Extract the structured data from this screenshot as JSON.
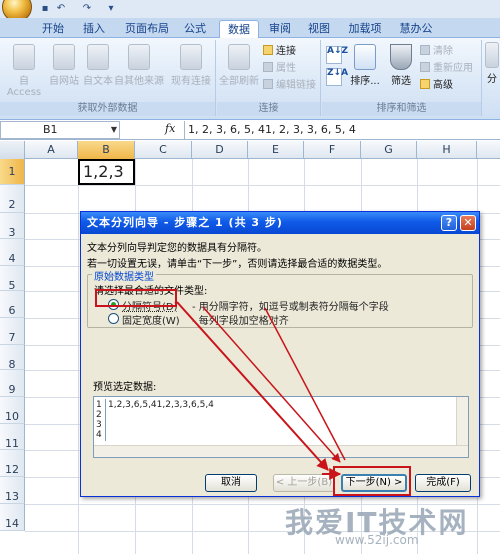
{
  "qat": {
    "undo": "↶",
    "redo": "↷",
    "more": "▾"
  },
  "tabs": [
    "开始",
    "插入",
    "页面布局",
    "公式",
    "数据",
    "审阅",
    "视图",
    "加载项",
    "慧办公"
  ],
  "ribbon": {
    "get_external": {
      "buttons": [
        "自 Access",
        "自网站",
        "自文本",
        "自其他来源",
        "现有连接"
      ],
      "label": "获取外部数据"
    },
    "connections": {
      "refresh": "全部刷新",
      "items": [
        "连接",
        "属性",
        "编辑链接"
      ],
      "label": "连接"
    },
    "sort_filter": {
      "az": "A↓Z",
      "za": "Z↓A",
      "sort": "排序...",
      "filter": "筛选",
      "items": [
        "清除",
        "重新应用",
        "高级"
      ],
      "label": "排序和筛选"
    },
    "more": "分"
  },
  "formula_bar": {
    "name": "B1",
    "fx": "fx",
    "content": "1, 2, 3, 6, 5, 41, 2, 3, 3, 6, 5, 4"
  },
  "sheet": {
    "columns": [
      "A",
      "B",
      "C",
      "D",
      "E",
      "F",
      "G",
      "H"
    ],
    "rows": [
      "1",
      "2",
      "3",
      "4",
      "5",
      "6",
      "7",
      "8",
      "9",
      "10",
      "11",
      "12",
      "13",
      "14"
    ],
    "b1_value": "1,2,3"
  },
  "dialog": {
    "title": "文本分列向导 - 步骤之 1 (共 3 步)",
    "help": "?",
    "close": "✕",
    "line1": "文本分列向导判定您的数据具有分隔符。",
    "line2": "若一切设置无误，请单击“下一步”，否则请选择最合适的数据类型。",
    "group_title": "原始数据类型",
    "group_hint": "请选择最合适的文件类型:",
    "option_delimited": "分隔符号(D)",
    "option_delimited_desc": "- 用分隔字符，如逗号或制表符分隔每个字段",
    "option_fixed": "固定宽度(W)",
    "option_fixed_desc": "- 每列字段加空格对齐",
    "preview_label": "预览选定数据:",
    "preview_rows": [
      "1,2,3,6,5,41,2,3,3,6,5,4",
      "",
      "",
      ""
    ],
    "preview_nums": [
      "1",
      "2",
      "3",
      "4"
    ],
    "btn_cancel": "取消",
    "btn_back": "< 上一步(B)",
    "btn_next": "下一步(N) >",
    "btn_finish": "完成(F)"
  },
  "watermark": {
    "main": "我爱IT技术网",
    "url": "www.52ij.com"
  },
  "colors": {
    "annotation_red": "#c8141a",
    "title_blue": "#0f5ae8"
  }
}
